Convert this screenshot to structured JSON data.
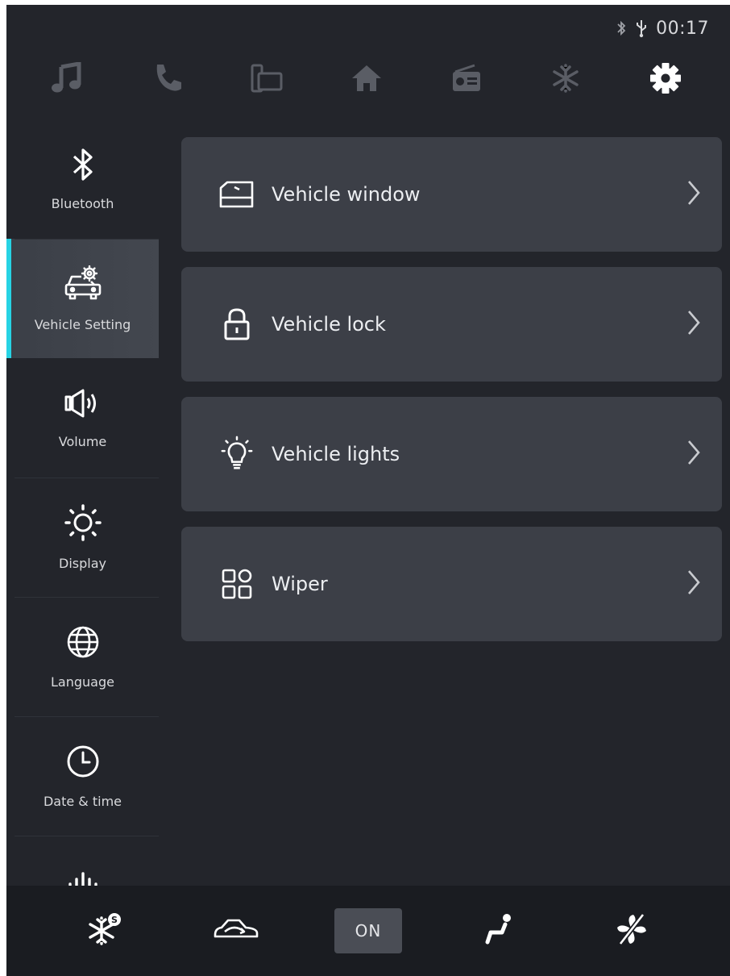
{
  "status": {
    "time": "00:17",
    "icons": [
      "bluetooth-icon",
      "usb-icon"
    ]
  },
  "topnav": {
    "items": [
      {
        "icon": "music-icon",
        "active": false
      },
      {
        "icon": "phone-icon",
        "active": false
      },
      {
        "icon": "mirror-link-icon",
        "active": false
      },
      {
        "icon": "home-icon",
        "active": false
      },
      {
        "icon": "radio-icon",
        "active": false
      },
      {
        "icon": "climate-icon",
        "active": false
      },
      {
        "icon": "settings-icon",
        "active": true
      }
    ]
  },
  "sidebar": {
    "items": [
      {
        "label": "Bluetooth",
        "icon": "bluetooth-icon"
      },
      {
        "label": "Vehicle Setting",
        "icon": "car-settings-icon",
        "active": true
      },
      {
        "label": "Volume",
        "icon": "speaker-icon"
      },
      {
        "label": "Display",
        "icon": "brightness-icon"
      },
      {
        "label": "Language",
        "icon": "globe-icon"
      },
      {
        "label": "Date & time",
        "icon": "clock-icon"
      },
      {
        "label": "",
        "icon": "equalizer-icon"
      }
    ]
  },
  "main": {
    "items": [
      {
        "label": "Vehicle window",
        "icon": "window-icon"
      },
      {
        "label": "Vehicle lock",
        "icon": "lock-icon"
      },
      {
        "label": "Vehicle lights",
        "icon": "light-bulb-icon"
      },
      {
        "label": "Wiper",
        "icon": "grid-icon"
      }
    ]
  },
  "bottombar": {
    "on_label": "ON",
    "items": [
      "ac-icon",
      "recirculation-icon",
      "on-button",
      "seat-airflow-icon",
      "fan-off-icon"
    ]
  },
  "colors": {
    "background": "#23252b",
    "card": "#3c3f47",
    "accent": "#27d3e4",
    "bottom_bar": "#1a1c21"
  }
}
